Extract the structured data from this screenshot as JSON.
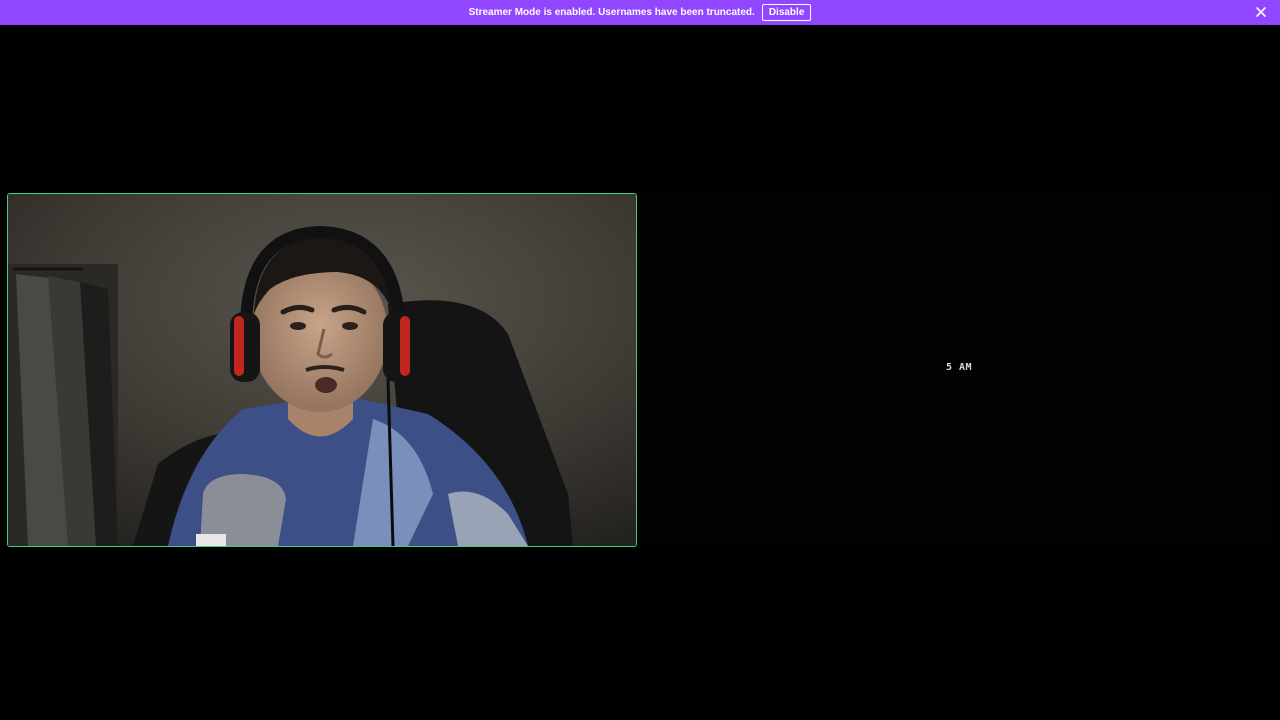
{
  "banner": {
    "message": "Streamer Mode is enabled. Usernames have been truncated.",
    "disable_label": "Disable",
    "close_icon": "close-icon",
    "background": "#9146ff"
  },
  "stage": {
    "camera_tile": {
      "speaking_indicator_color": "#3ad27a"
    },
    "screen_share_tile": {
      "clock_text": "5 AM"
    }
  }
}
